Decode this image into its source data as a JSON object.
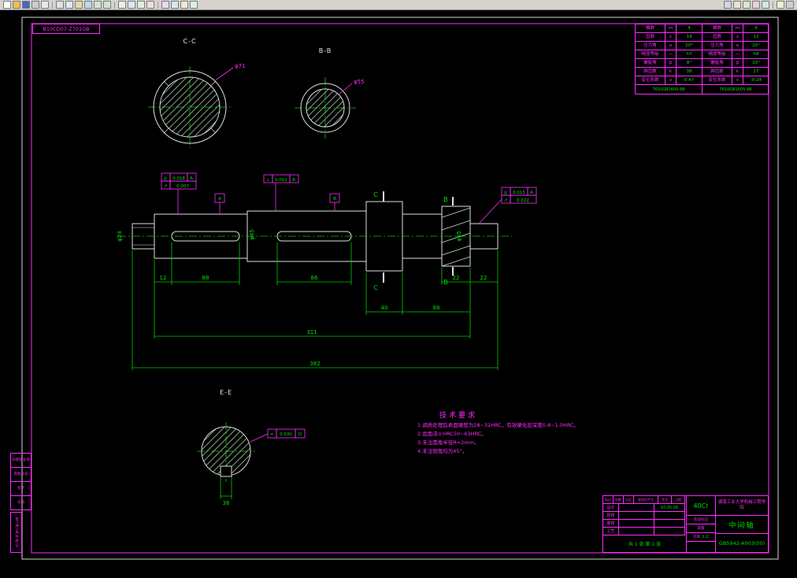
{
  "toolbar": {
    "groups": {
      "file": [
        {
          "name": "new-icon",
          "style": "background:#fffffe"
        },
        {
          "name": "open-icon",
          "style": "background:#f0c050"
        },
        {
          "name": "save-icon",
          "style": "background:#4a66c8"
        },
        {
          "name": "plot-icon",
          "style": "background:#c8ccd4"
        },
        {
          "name": "print-preview-icon",
          "style": "background:#e8eaf0"
        }
      ],
      "edit": [
        {
          "name": "cut-icon",
          "style": "background:#e2e2e2"
        },
        {
          "name": "copy-icon",
          "style": "background:#dfe7f7"
        },
        {
          "name": "paste-icon",
          "style": "background:#e7d9a7"
        },
        {
          "name": "match-properties-icon",
          "style": "background:#bcd8f0"
        },
        {
          "name": "undo-icon",
          "style": "background:#cfe5cf"
        },
        {
          "name": "redo-icon",
          "style": "background:#cfe5cf"
        }
      ],
      "view": [
        {
          "name": "pan-icon",
          "style": "background:#ececec"
        },
        {
          "name": "zoom-window-icon",
          "style": "background:#dce8f5"
        },
        {
          "name": "zoom-extents-icon",
          "style": "background:#dcf0dc"
        },
        {
          "name": "regen-icon",
          "style": "background:#f0dcdc"
        }
      ],
      "insert": [
        {
          "name": "insert-block-icon",
          "style": "background:#e6d8f0"
        },
        {
          "name": "insert-table-icon",
          "style": "background:#d8e8f0"
        },
        {
          "name": "insert-image-icon",
          "style": "background:#f0e8d8"
        },
        {
          "name": "hyperlink-icon",
          "style": "background:#d8f0e8"
        }
      ],
      "settings": [
        {
          "name": "osnap-icon",
          "style": "background:#cfd6e8"
        },
        {
          "name": "grid-icon",
          "style": "background:#e8e2cf"
        },
        {
          "name": "ortho-icon",
          "style": "background:#d6e8cf"
        },
        {
          "name": "polar-icon",
          "style": "background:#e8cfd6"
        },
        {
          "name": "dyn-input-icon",
          "style": "background:#cfe8e6"
        }
      ],
      "window": [
        {
          "name": "help-icon",
          "style": "background:#f0f0d0"
        },
        {
          "name": "minimize-icon",
          "style": "background:#d0d0d0"
        }
      ]
    }
  },
  "canvas": {
    "frame": {
      "corner_label": "B10CD07-Z701GB"
    },
    "sections": {
      "cc": "C-C",
      "bb": "B-B",
      "ee": "E-E"
    },
    "cuts": {
      "c": "C",
      "b": "B"
    },
    "datums": {
      "a": "A",
      "b": "B"
    },
    "dims": {
      "cc_dia": "φ71",
      "bb_dia": "φ55",
      "d12": "12",
      "d88a": "88",
      "d86": "86",
      "d22a": "22",
      "d22b": "22",
      "d40": "40",
      "d88b": "88",
      "d311": "311",
      "d382": "382",
      "left_dia": "φ24",
      "mid_dia": "φ45",
      "spline_dia": "φ55",
      "ee_w": "36"
    },
    "gdt": {
      "g1_sym": "◎",
      "g1_val": "0.018",
      "g1_dat": "A",
      "g1b_sym": "↗",
      "g1b_val": "0.007",
      "g2_sym": "⊥",
      "g2_val": "0.012",
      "g2_dat": "A",
      "g3_sym": "◎",
      "g3_val": "0.015",
      "g3_dat": "A",
      "g3b_sym": "↗",
      "g3b_val": "0.022",
      "g4_sym": "=",
      "g4_val": "0.030",
      "g4_dat": "D"
    },
    "tech": {
      "title": "技术要求",
      "l1": "1.调质处理后表面硬度为28~32HRC，有效硬化层深度0.8~1.0HRC。",
      "l2": "2.齿面淬火HRC50~63HRC。",
      "l3": "3.未注圆角半径R=2mm。",
      "l4": "4.未注倒角均为45°。"
    },
    "param_table": {
      "rows": [
        {
          "l1": "模数",
          "s1": "m",
          "v1": "4",
          "l2": "模数",
          "s2": "m",
          "v2": "4"
        },
        {
          "l1": "齿数",
          "s1": "z",
          "v1": "14",
          "l2": "齿数",
          "s2": "z",
          "v2": "13"
        },
        {
          "l1": "压力角",
          "s1": "α",
          "v1": "20°",
          "l2": "压力角",
          "s2": "α",
          "v2": "20°"
        },
        {
          "l1": "精度等级",
          "s1": "—",
          "v1": "h7",
          "l2": "精度等级",
          "s2": "—",
          "v2": "h8"
        },
        {
          "l1": "螺旋角",
          "s1": "β",
          "v1": "8°",
          "l2": "螺旋角",
          "s2": "β",
          "v2": "20°"
        },
        {
          "l1": "跨齿数",
          "s1": "k",
          "v1": "38",
          "l2": "跨齿数",
          "s2": "k",
          "v2": "27"
        },
        {
          "l1": "变位系数",
          "s1": "x",
          "v1": "0.47",
          "l2": "变位系数",
          "s2": "x",
          "v2": "-0.24"
        }
      ],
      "footer_left": "7610GB1605-88",
      "footer_right": "7610GB1605-88"
    },
    "title_block": {
      "header_cells": [
        "标记",
        "处数",
        "分区",
        "更改文件号",
        "签名",
        "日期"
      ],
      "rows": [
        {
          "role": "设计",
          "name": "",
          "date": "10.05.26"
        },
        {
          "role": "校核",
          "name": "",
          "date": ""
        },
        {
          "role": "审核",
          "name": "",
          "date": ""
        },
        {
          "role": "工艺",
          "name": "",
          "date": ""
        }
      ],
      "sheet_info": "共 1 张 第 1 张",
      "material": "40Cr",
      "stage_label": "阶段标记",
      "weight_label": "质量",
      "scale_label": "比例",
      "scale_value": "1:2",
      "school": "湖南工业大学机械工程学院",
      "part_name": "中间轴",
      "drawing_no": "GB5942-A003(00)"
    },
    "margin": {
      "rows": [
        "旧底图总号",
        "底图总号",
        "签字",
        "日期"
      ],
      "side_label": "借(通)用件登记"
    }
  }
}
